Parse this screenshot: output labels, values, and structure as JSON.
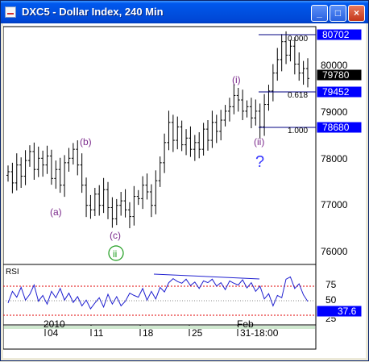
{
  "window": {
    "title": "DXC5 - Dollar Index, 240 Min",
    "buttons": [
      "_",
      "□",
      "×"
    ]
  },
  "price_panel": {
    "y_ticks": [
      "80000",
      "79000",
      "78000",
      "77000",
      "76000"
    ],
    "price_tags": [
      {
        "label": "80702",
        "style": "highlight"
      },
      {
        "label": "79780",
        "style": "current"
      },
      {
        "label": "79452",
        "style": "highlight"
      },
      {
        "label": "78680",
        "style": "highlight"
      }
    ],
    "fib_levels": [
      "0.000",
      "0.618",
      "1.000"
    ],
    "wave_labels": [
      "(a)",
      "(b)",
      "(c)",
      "ii",
      "(i)",
      "(ii)",
      "?"
    ]
  },
  "rsi_panel": {
    "title": "RSI",
    "y_ticks": [
      "75",
      "50",
      "25"
    ],
    "current_tag": "37.6"
  },
  "time_axis": {
    "labels": [
      "2010",
      "04",
      "11",
      "18",
      "25",
      "Feb",
      "31-18:00"
    ]
  },
  "colors": {
    "title_bar": "#0050e0",
    "highlight_tag": "#0000ff",
    "current_tag": "#000000",
    "wave_label": "#7b2a8c",
    "ii_circle": "#1a9b1a",
    "question_mark": "#3a3aff",
    "rsi_line": "#2020d0",
    "rsi_level_line": "#e00000"
  },
  "chart_data": {
    "type": "ohlc",
    "y_range": [
      75650,
      80900
    ],
    "x_labels": [
      "2010",
      "04",
      "11",
      "18",
      "25",
      "Feb",
      "31-18:00"
    ],
    "closes": [
      77700,
      77450,
      77850,
      77600,
      77950,
      78150,
      77750,
      78000,
      77850,
      78050,
      77550,
      77750,
      77400,
      77900,
      78000,
      78200,
      77850,
      77400,
      76950,
      76850,
      77200,
      76950,
      77300,
      76900,
      76650,
      76950,
      77050,
      76850,
      76700,
      77150,
      77100,
      77400,
      77250,
      76950,
      77500,
      77900,
      78350,
      78800,
      78400,
      78700,
      78300,
      78450,
      78200,
      78350,
      78200,
      78650,
      78400,
      78800,
      78600,
      78850,
      79050,
      79150,
      79400,
      79300,
      79050,
      79150,
      78900,
      79050,
      78700,
      79200,
      79500,
      79900,
      80200,
      80600,
      80300,
      80500,
      80100,
      79900,
      80000,
      79780
    ],
    "fib_values": {
      "0.000": 80702,
      "0.618": 79452,
      "1.000": 78680
    },
    "rsi": {
      "y_range": [
        0,
        100
      ],
      "levels": [
        75,
        50,
        25
      ],
      "values": [
        35,
        55,
        45,
        62,
        40,
        50,
        66,
        38,
        48,
        33,
        55,
        44,
        60,
        40,
        52,
        36,
        46,
        30,
        40,
        25,
        35,
        44,
        28,
        50,
        33,
        46,
        30,
        38,
        52,
        48,
        45,
        60,
        40,
        55,
        42,
        62,
        54,
        70,
        77,
        72,
        69,
        76,
        65,
        71,
        60,
        73,
        70,
        76,
        64,
        70,
        58,
        73,
        69,
        66,
        75,
        61,
        70,
        55,
        64,
        42,
        51,
        30,
        48,
        44,
        76,
        80,
        60,
        68,
        49,
        37.6
      ]
    }
  }
}
